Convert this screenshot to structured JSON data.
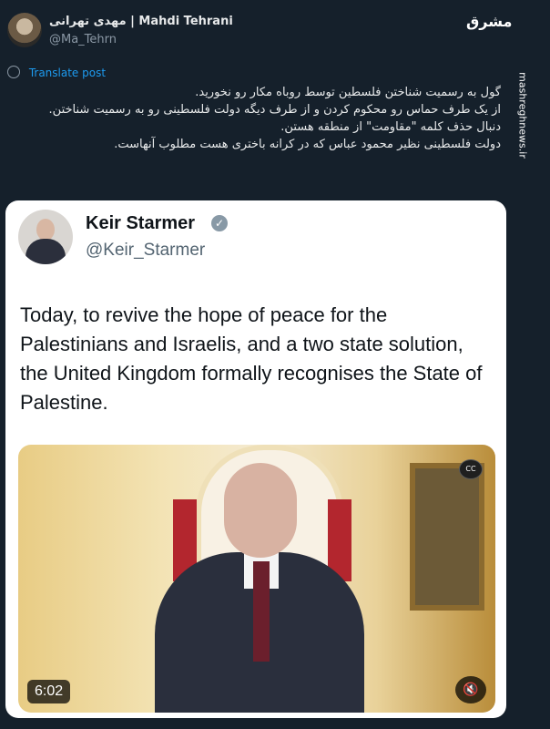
{
  "tweet": {
    "display_name": "مهدی تهرانی | Mahdi Tehrani",
    "handle": "@Ma_Tehrn",
    "translate_label": "Translate post",
    "text_lines": [
      "گول به رسمیت شناختن فلسطین توسط روباه مکار رو نخورید.",
      "از یک طرف حماس رو محکوم کردن و از طرف دیگه دولت فلسطینی رو به رسمیت شناختن.",
      "دنبال حذف کلمه \"مقاومت\" از منطقه هستن.",
      "دولت فلسطینی نظیر محمود عباس که در کرانه باختری هست مطلوب آنهاست."
    ]
  },
  "branding": {
    "logo_text": "مشرق",
    "side_text": "mashreghnews.ir"
  },
  "quoted_tweet": {
    "display_name": "Keir Starmer",
    "handle": "@Keir_Starmer",
    "text": "Today, to revive the hope of peace for the Palestinians and Israelis, and a two state solution, the United Kingdom formally recognises the State of Palestine.",
    "video": {
      "duration": "6:02",
      "cc_label": "CC",
      "mute_icon": "speaker-muted-icon"
    }
  },
  "colors": {
    "background": "#15202b",
    "link": "#1d9bf0",
    "card": "#ffffff"
  }
}
